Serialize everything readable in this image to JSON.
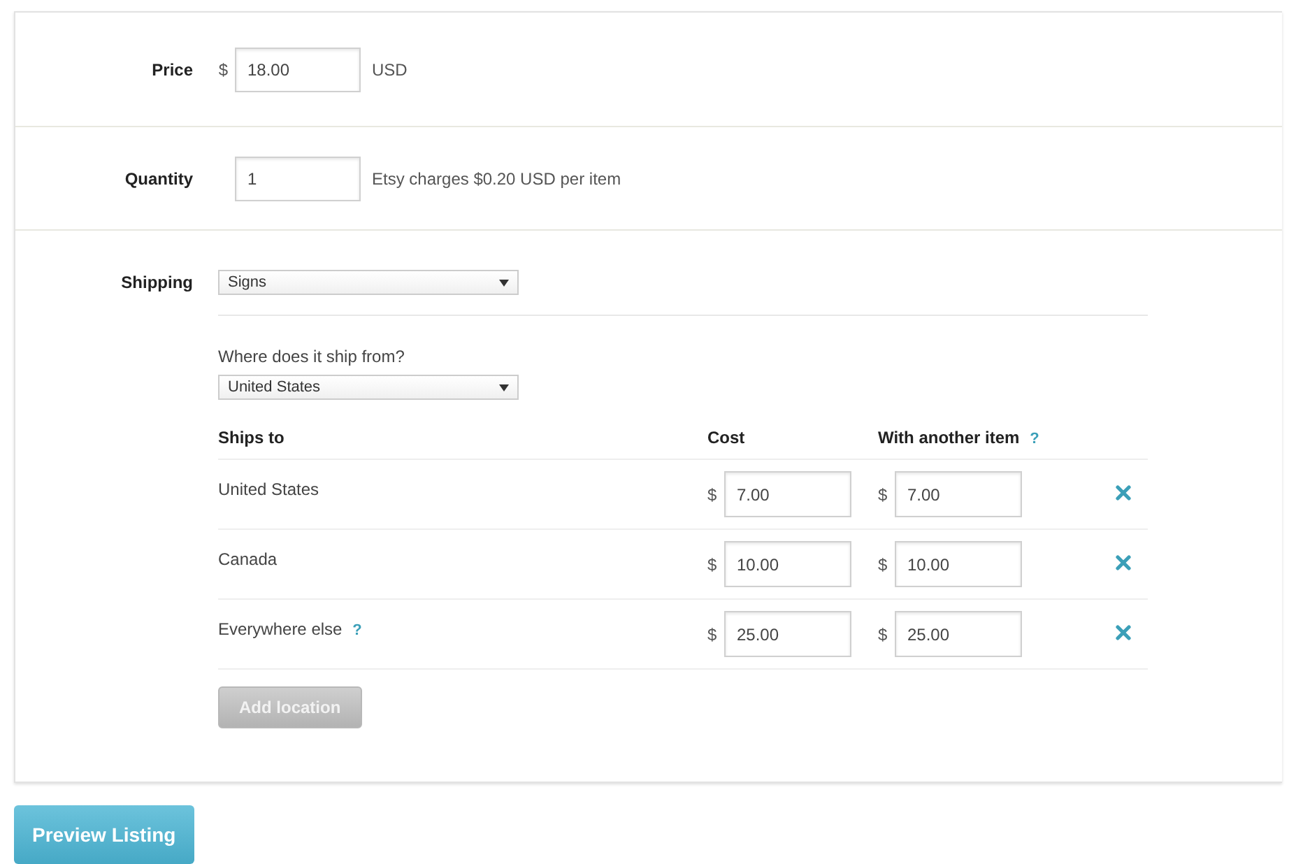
{
  "price": {
    "label": "Price",
    "currency": "$",
    "value": "18.00",
    "unit": "USD"
  },
  "quantity": {
    "label": "Quantity",
    "value": "1",
    "note": "Etsy charges $0.20 USD per item"
  },
  "shipping": {
    "label": "Shipping",
    "profile": "Signs",
    "origin_label": "Where does it ship from?",
    "origin": "United States",
    "columns": [
      {
        "label": "Ships to"
      },
      {
        "label": "Cost"
      },
      {
        "label": "With another item",
        "help": "?"
      }
    ],
    "rows": [
      {
        "destination": "United States",
        "cost": "7.00",
        "additional": "7.00"
      },
      {
        "destination": "Canada",
        "cost": "10.00",
        "additional": "10.00"
      },
      {
        "destination": "Everywhere else",
        "help": "?",
        "cost": "25.00",
        "additional": "25.00"
      }
    ],
    "currency": "$",
    "add_button": {
      "label": "Add location",
      "disabled": true
    }
  },
  "preview_button": "Preview Listing"
}
